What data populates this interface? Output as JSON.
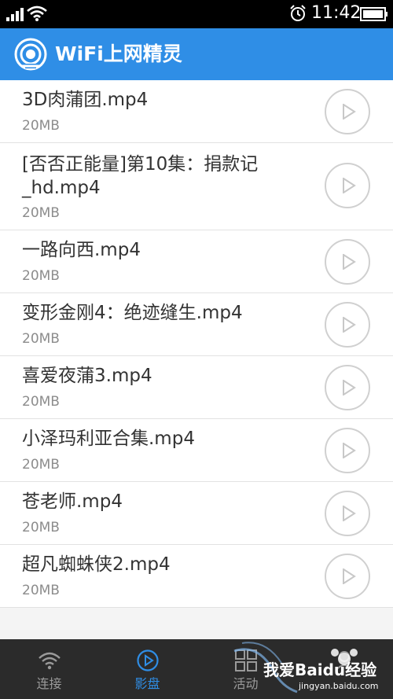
{
  "status_bar": {
    "time": "11:42",
    "icons": [
      "signal-icon",
      "wifi-icon",
      "alarm-icon",
      "battery-icon"
    ]
  },
  "header": {
    "title": "WiFi上网精灵",
    "background_color": "#2f8ee6"
  },
  "videos": [
    {
      "name": "3D肉蒲团.mp4",
      "size": "20MB"
    },
    {
      "name": "[否否正能量]第10集：捐款记_hd.mp4",
      "size": "20MB"
    },
    {
      "name": "一路向西.mp4",
      "size": "20MB"
    },
    {
      "name": "变形金刚4：绝迹缝生.mp4",
      "size": "20MB"
    },
    {
      "name": "喜爱夜蒲3.mp4",
      "size": "20MB"
    },
    {
      "name": "小泽玛利亚合集.mp4",
      "size": "20MB"
    },
    {
      "name": "苍老师.mp4",
      "size": "20MB"
    },
    {
      "name": "超凡蜘蛛侠2.mp4",
      "size": "20MB"
    }
  ],
  "bottom_nav": {
    "items": [
      {
        "label": "连接",
        "icon": "wifi-icon",
        "active": false
      },
      {
        "label": "影盘",
        "icon": "play-circle-icon",
        "active": true
      },
      {
        "label": "活动",
        "icon": "grid-icon",
        "active": false
      },
      {
        "label": "",
        "icon": "user-icon",
        "active": false
      }
    ],
    "active_color": "#2f8ee6"
  },
  "watermark": {
    "text": "我爱Baidu经验",
    "sub": "jingyan.baidu.com"
  }
}
